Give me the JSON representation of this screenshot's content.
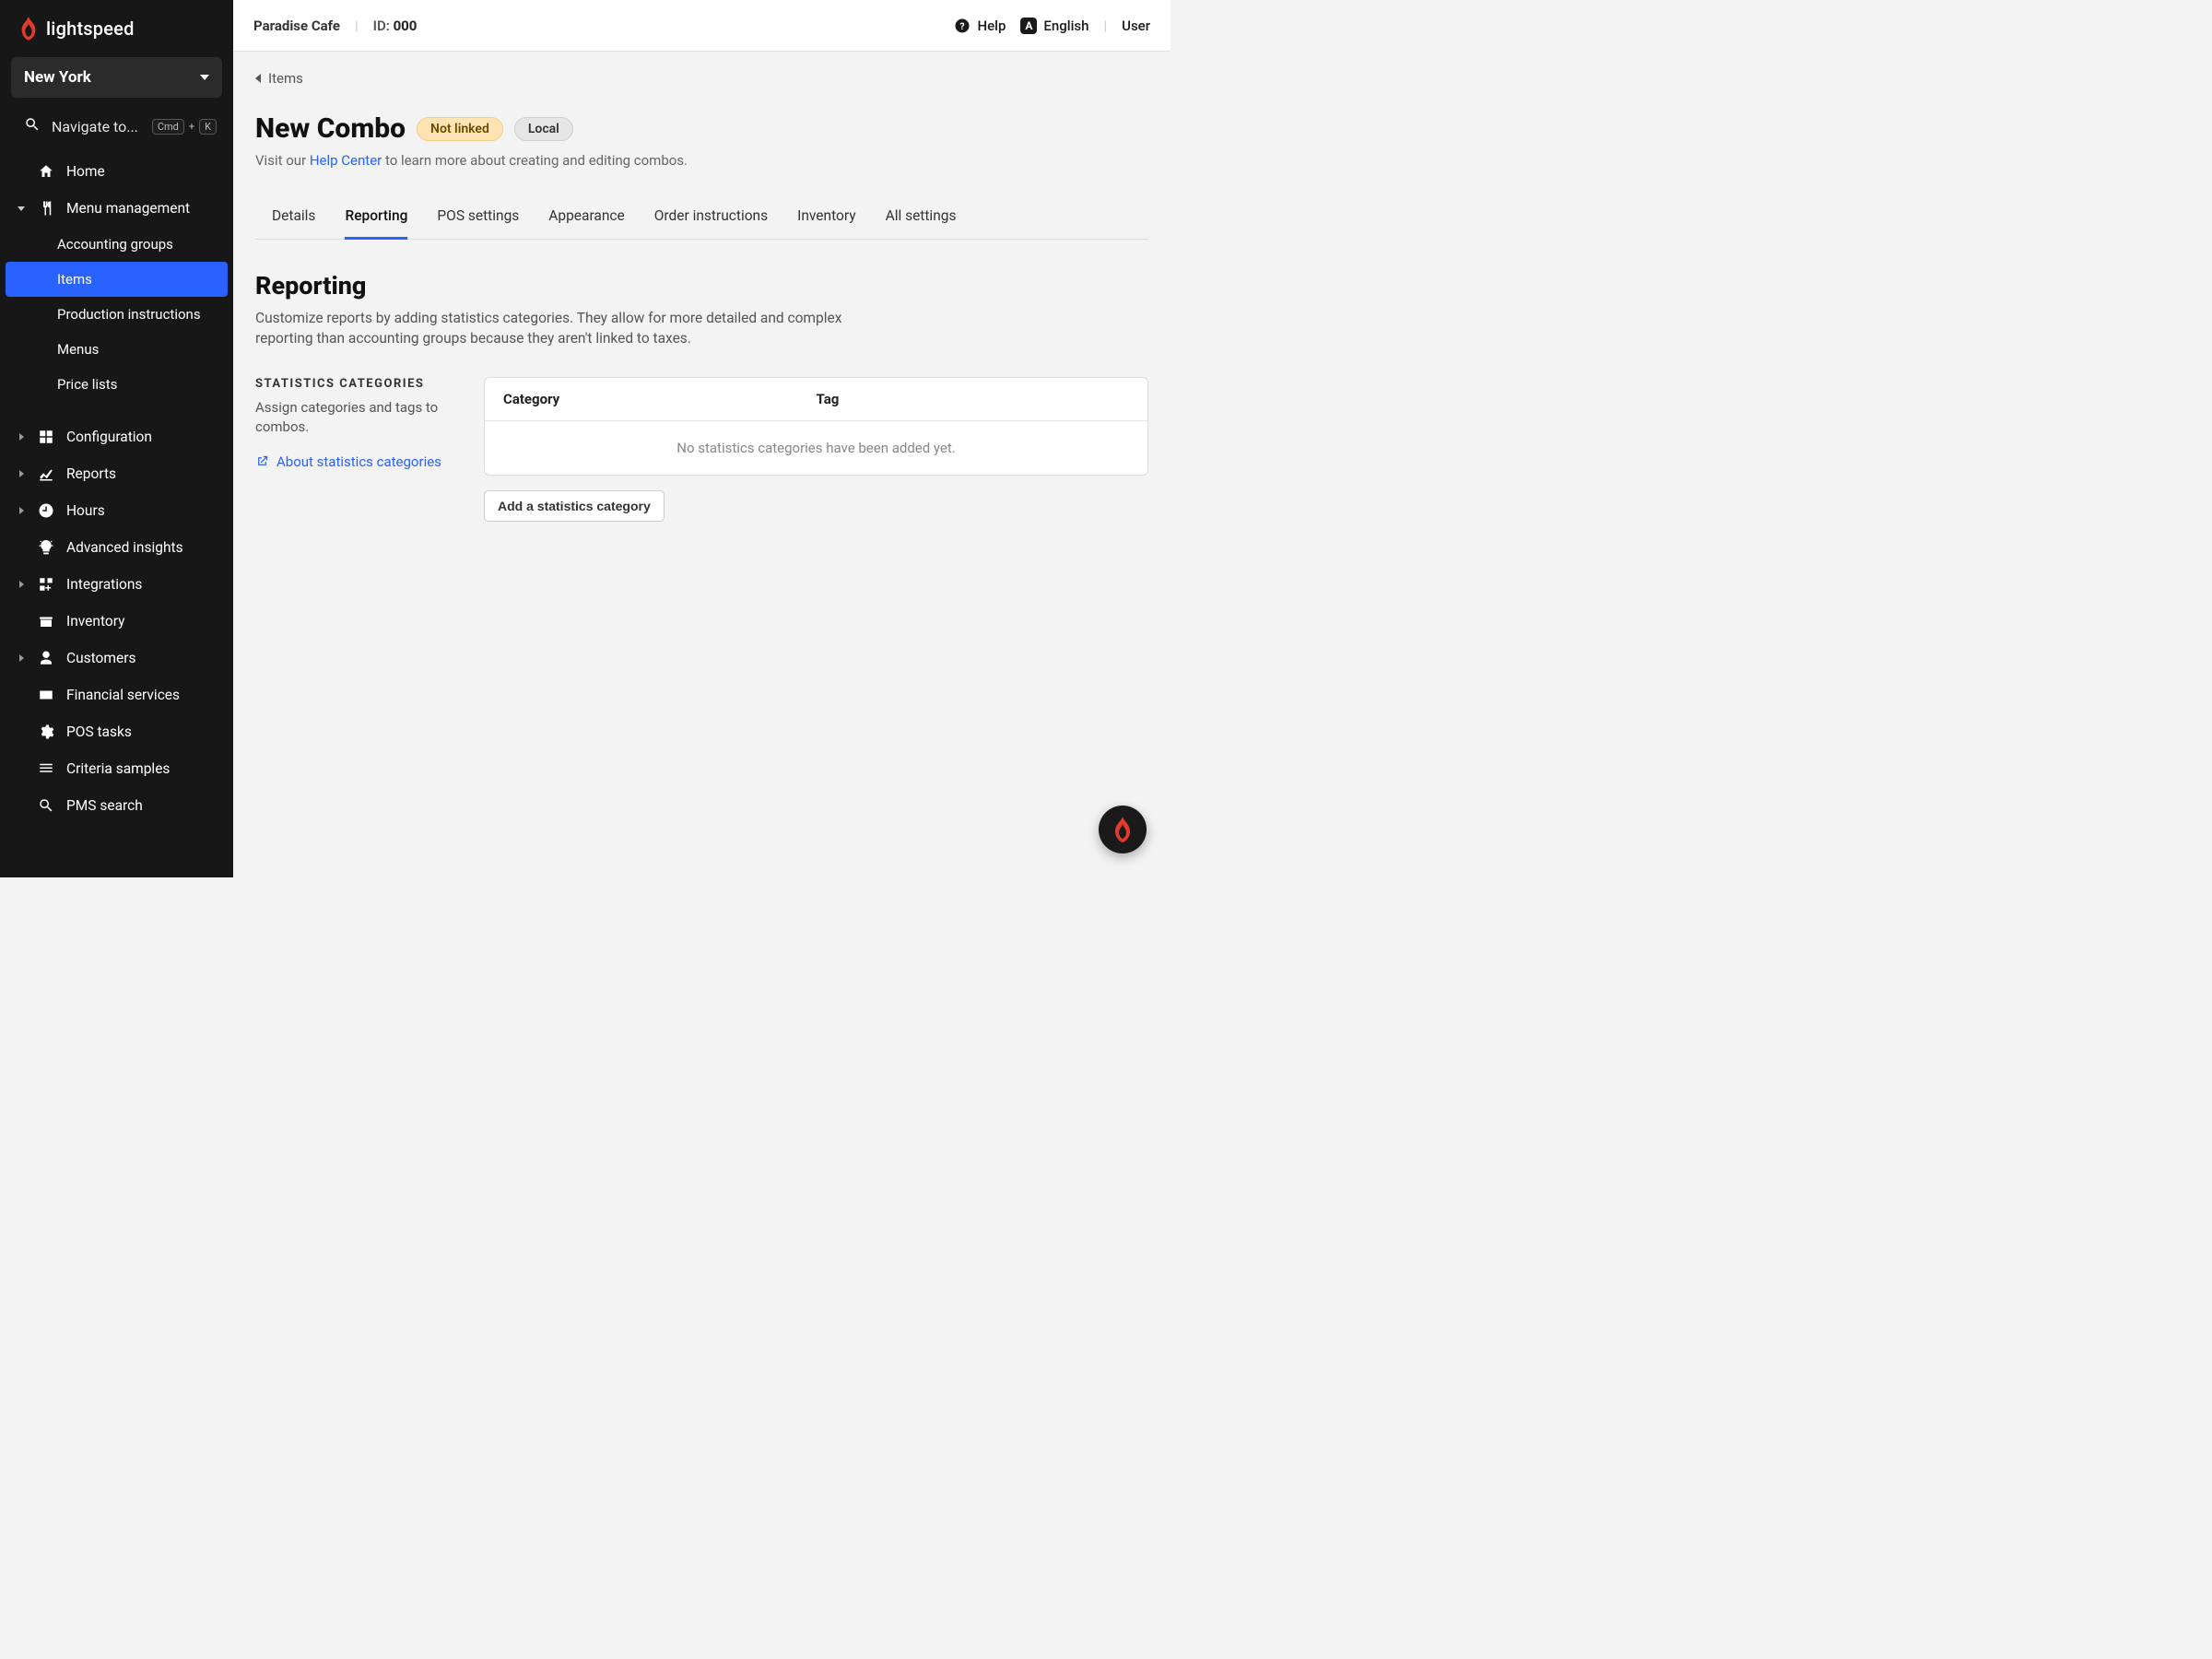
{
  "brand": {
    "name": "lightspeed"
  },
  "sidebar": {
    "location": "New York",
    "search_placeholder": "Navigate to...",
    "kbd_cmd": "Cmd",
    "kbd_plus": "+",
    "kbd_k": "K",
    "items": {
      "home": "Home",
      "menu_mgmt": "Menu management",
      "configuration": "Configuration",
      "reports": "Reports",
      "hours": "Hours",
      "advanced_insights": "Advanced insights",
      "integrations": "Integrations",
      "inventory": "Inventory",
      "customers": "Customers",
      "financial_services": "Financial services",
      "pos_tasks": "POS tasks",
      "criteria_samples": "Criteria samples",
      "pms_search": "PMS search"
    },
    "submenu": {
      "accounting_groups": "Accounting groups",
      "items": "Items",
      "production_instructions": "Production instructions",
      "menus": "Menus",
      "price_lists": "Price lists"
    }
  },
  "topbar": {
    "business": "Paradise Cafe",
    "id_prefix": "ID: ",
    "id_value": "000",
    "help": "Help",
    "language": "English",
    "lang_badge": "A",
    "user": "User"
  },
  "breadcrumb": {
    "items_label": "Items"
  },
  "page": {
    "title": "New Combo",
    "badge_notlinked": "Not linked",
    "badge_local": "Local",
    "sub_prefix": "Visit our ",
    "sub_link": "Help Center",
    "sub_suffix": " to learn more about creating and editing combos."
  },
  "tabs": {
    "details": "Details",
    "reporting": "Reporting",
    "pos_settings": "POS settings",
    "appearance": "Appearance",
    "order_instructions": "Order instructions",
    "inventory": "Inventory",
    "all_settings": "All settings"
  },
  "section": {
    "title": "Reporting",
    "desc": "Customize reports by adding statistics categories. They allow for more detailed and complex reporting than accounting groups because they aren't linked to taxes."
  },
  "stats": {
    "caps_label": "STATISTICS CATEGORIES",
    "hint": "Assign categories and tags to combos.",
    "about_link": "About statistics categories",
    "col_category": "Category",
    "col_tag": "Tag",
    "empty": "No statistics categories have been added yet.",
    "add_button": "Add a statistics category"
  }
}
